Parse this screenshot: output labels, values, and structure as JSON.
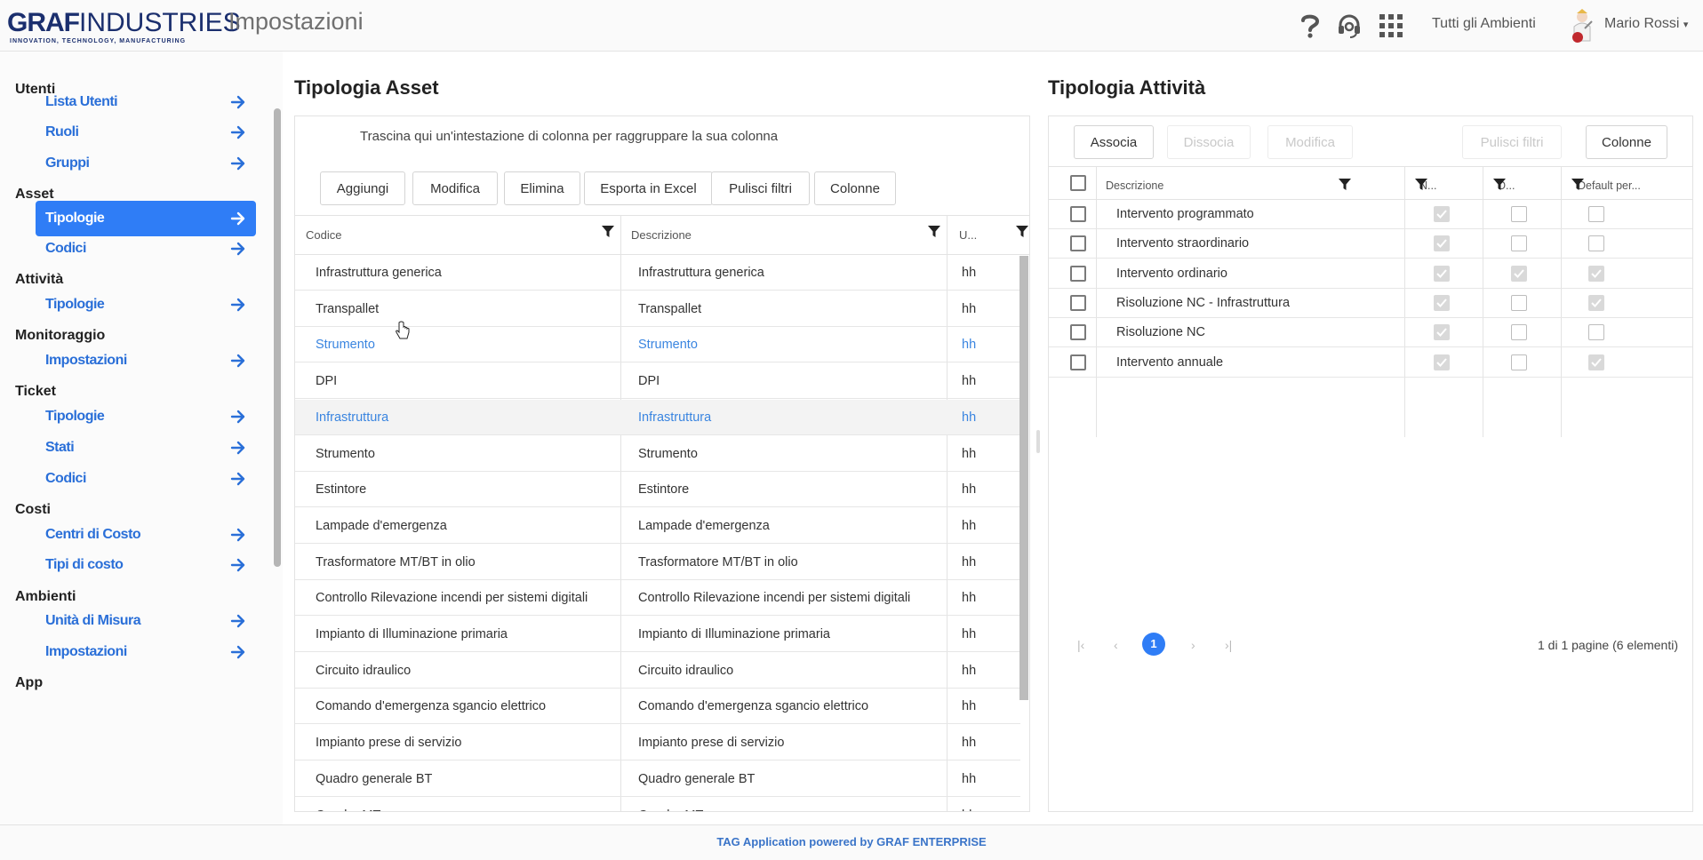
{
  "header": {
    "logo_main_bold": "GRAF",
    "logo_main_light": "INDUSTRIES",
    "logo_tagline": "INNOVATION, TECHNOLOGY, MANUFACTURING",
    "page_title": "Impostazioni",
    "environments_link": "Tutti gli Ambienti",
    "user_name": "Mario Rossi",
    "icons": [
      "help-icon",
      "support-headset-icon",
      "apps-grid-icon",
      "dropdown-caret-icon"
    ]
  },
  "sidebar": {
    "sections": [
      {
        "label": "Utenti",
        "items": [
          {
            "label": "Lista Utenti"
          },
          {
            "label": "Ruoli"
          },
          {
            "label": "Gruppi"
          }
        ]
      },
      {
        "label": "Asset",
        "items": [
          {
            "label": "Tipologie",
            "active": true
          },
          {
            "label": "Codici"
          }
        ]
      },
      {
        "label": "Attività",
        "items": [
          {
            "label": "Tipologie"
          }
        ]
      },
      {
        "label": "Monitoraggio",
        "items": [
          {
            "label": "Impostazioni"
          }
        ]
      },
      {
        "label": "Ticket",
        "items": [
          {
            "label": "Tipologie"
          },
          {
            "label": "Stati"
          },
          {
            "label": "Codici"
          }
        ]
      },
      {
        "label": "Costi",
        "items": [
          {
            "label": "Centri di Costo"
          },
          {
            "label": "Tipi di costo"
          }
        ]
      },
      {
        "label": "Ambienti",
        "items": [
          {
            "label": "Unità di Misura"
          },
          {
            "label": "Impostazioni"
          }
        ]
      },
      {
        "label": "App",
        "items": []
      }
    ],
    "active_color": "#2f7df6"
  },
  "asset_panel": {
    "title": "Tipologia Asset",
    "group_hint": "Trascina qui un'intestazione di colonna per raggruppare la sua colonna",
    "buttons": [
      "Aggiungi",
      "Modifica",
      "Elimina",
      "Esporta in Excel",
      "Pulisci filtri",
      "Colonne"
    ],
    "columns": [
      "Codice",
      "Descrizione",
      "U..."
    ],
    "rows": [
      {
        "codice": "Infrastruttura generica",
        "descrizione": "Infrastruttura generica",
        "um": "hh"
      },
      {
        "codice": "Transpallet",
        "descrizione": "Transpallet",
        "um": "hh"
      },
      {
        "codice": "Strumento",
        "descrizione": "Strumento",
        "um": "hh",
        "state": "hover"
      },
      {
        "codice": "DPI",
        "descrizione": "DPI",
        "um": "hh"
      },
      {
        "codice": "Infrastruttura",
        "descrizione": "Infrastruttura",
        "um": "hh",
        "state": "selected"
      },
      {
        "codice": "Strumento",
        "descrizione": "Strumento",
        "um": "hh"
      },
      {
        "codice": "Estintore",
        "descrizione": "Estintore",
        "um": "hh"
      },
      {
        "codice": "Lampade d'emergenza",
        "descrizione": "Lampade d'emergenza",
        "um": "hh"
      },
      {
        "codice": "Trasformatore MT/BT in olio",
        "descrizione": "Trasformatore MT/BT in olio",
        "um": "hh"
      },
      {
        "codice": "Controllo Rilevazione incendi per sistemi digitali",
        "descrizione": "Controllo Rilevazione incendi per sistemi digitali",
        "um": "hh"
      },
      {
        "codice": "Impianto di Illuminazione primaria",
        "descrizione": "Impianto di Illuminazione primaria",
        "um": "hh"
      },
      {
        "codice": "Circuito idraulico",
        "descrizione": "Circuito idraulico",
        "um": "hh"
      },
      {
        "codice": "Comando d'emergenza sgancio elettrico",
        "descrizione": "Comando d'emergenza sgancio elettrico",
        "um": "hh"
      },
      {
        "codice": "Impianto prese di servizio",
        "descrizione": "Impianto prese di servizio",
        "um": "hh"
      },
      {
        "codice": "Quadro generale BT",
        "descrizione": "Quadro generale BT",
        "um": "hh"
      },
      {
        "codice": "Quadro MT",
        "descrizione": "Quadro MT",
        "um": "hh"
      }
    ]
  },
  "activity_panel": {
    "title": "Tipologia Attività",
    "buttons": [
      {
        "label": "Associa",
        "enabled": true
      },
      {
        "label": "Dissocia",
        "enabled": false
      },
      {
        "label": "Modifica",
        "enabled": false
      },
      {
        "label": "Pulisci filtri",
        "enabled": false
      },
      {
        "label": "Colonne",
        "enabled": true
      }
    ],
    "columns": [
      "Descrizione",
      "N...",
      "D...",
      "Default per..."
    ],
    "rows": [
      {
        "descrizione": "Intervento programmato",
        "n": true,
        "d": false,
        "default": false
      },
      {
        "descrizione": "Intervento straordinario",
        "n": true,
        "d": false,
        "default": false
      },
      {
        "descrizione": "Intervento ordinario",
        "n": true,
        "d": true,
        "default": true
      },
      {
        "descrizione": "Risoluzione NC - Infrastruttura",
        "n": true,
        "d": false,
        "default": true
      },
      {
        "descrizione": "Risoluzione NC",
        "n": true,
        "d": false,
        "default": false
      },
      {
        "descrizione": "Intervento annuale",
        "n": true,
        "d": false,
        "default": true
      }
    ],
    "pager": {
      "current_page": "1",
      "summary": "1 di 1 pagine (6 elementi)"
    }
  },
  "footer": {
    "text": "TAG Application powered by GRAF ENTERPRISE"
  }
}
